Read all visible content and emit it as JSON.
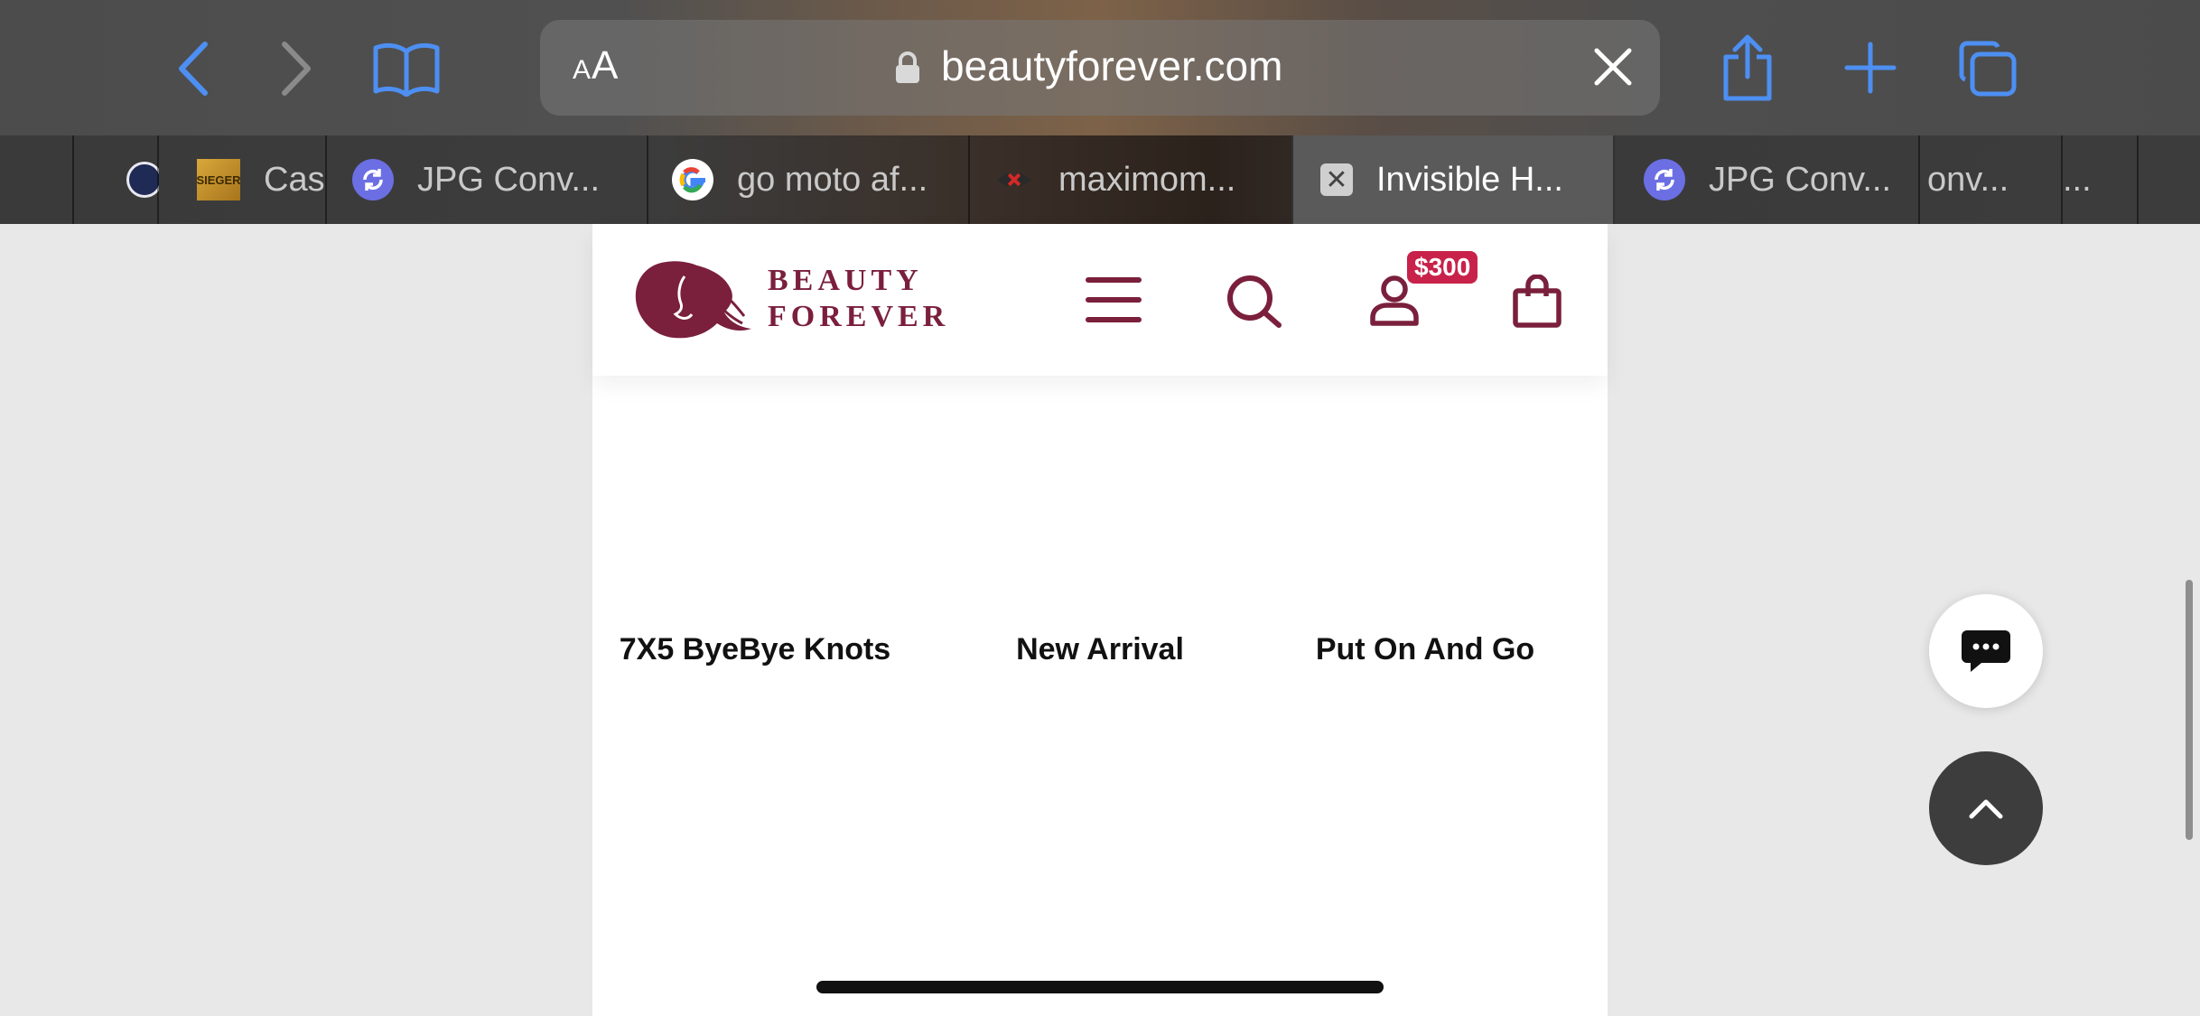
{
  "browser": {
    "aa_label_small": "A",
    "aa_label_large": "A",
    "url": "beautyforever.com",
    "tabs": [
      {
        "label": "",
        "favicon": "seal-icon"
      },
      {
        "label": "Casi",
        "favicon": "sieger-icon"
      },
      {
        "label": "JPG Conv...",
        "favicon": "sync-icon"
      },
      {
        "label": "go moto af...",
        "favicon": "google-icon"
      },
      {
        "label": "maximom...",
        "favicon": "maximom-icon"
      },
      {
        "label": "Invisible H...",
        "favicon": "close-box-icon",
        "active": true
      },
      {
        "label": "JPG Conv...",
        "favicon": "sync-icon"
      },
      {
        "label": "onv...",
        "favicon": ""
      },
      {
        "label": "...",
        "favicon": ""
      }
    ],
    "sieger_text": "SIEGER"
  },
  "site": {
    "logo_line1": "BEAUTY",
    "logo_line2": "FOREVER",
    "badge": "$300",
    "brand_color": "#7a1f3c",
    "badge_color": "#c8224a"
  },
  "categories": [
    {
      "label": "7X5 ByeBye Knots"
    },
    {
      "label": "New Arrival"
    },
    {
      "label": "Put On And Go"
    }
  ]
}
